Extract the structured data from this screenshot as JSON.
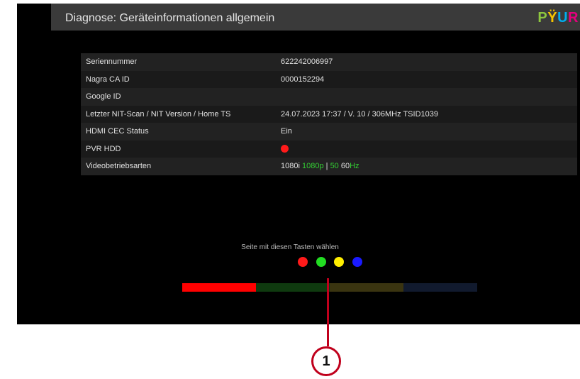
{
  "header": {
    "title": "Diagnose: Geräteinformationen allgemein",
    "logo": {
      "letters": [
        "P",
        "Ÿ",
        "U",
        "R"
      ],
      "colors": [
        "#8dc63f",
        "#f5c400",
        "#00aeef",
        "#e6007e"
      ]
    }
  },
  "table": {
    "rows": [
      {
        "label": "Seriennummer",
        "value": "622242006997"
      },
      {
        "label": "Nagra CA ID",
        "value": "0000152294"
      },
      {
        "label": "Google ID",
        "value": ""
      },
      {
        "label": "Letzter NIT-Scan / NIT Version / Home TS",
        "value": "24.07.2023 17:37 / V. 10 / 306MHz  TSID1039"
      },
      {
        "label": "HDMI CEC Status",
        "value": "Ein"
      },
      {
        "label": "PVR HDD",
        "value": "",
        "status_icon": "red-status-dot",
        "status_color": "#ff1a1a"
      },
      {
        "label": "Videobetriebsarten",
        "value_parts": [
          {
            "text": "1080i ",
            "color": "#e0e0e0"
          },
          {
            "text": "1080p",
            "color": "#33cc33"
          },
          {
            "text": " | ",
            "color": "#e0e0e0"
          },
          {
            "text": "50",
            "color": "#33cc33"
          },
          {
            "text": " 60",
            "color": "#e0e0e0"
          },
          {
            "text": "Hz",
            "color": "#33cc33"
          }
        ]
      }
    ]
  },
  "navigation": {
    "hint": "Seite mit diesen Tasten wählen",
    "keys": [
      {
        "name": "red-key",
        "color": "#ff1a1a"
      },
      {
        "name": "green-key",
        "color": "#22dd22"
      },
      {
        "name": "yellow-key",
        "color": "#ffee00"
      },
      {
        "name": "blue-key",
        "color": "#1a1aff"
      }
    ],
    "page_indicator": {
      "pages": 4,
      "active_page": 1,
      "colors": [
        "#ff0000",
        "#0f3a0f",
        "#3a3410",
        "#111a2e"
      ]
    }
  },
  "callout": {
    "label": "1"
  }
}
